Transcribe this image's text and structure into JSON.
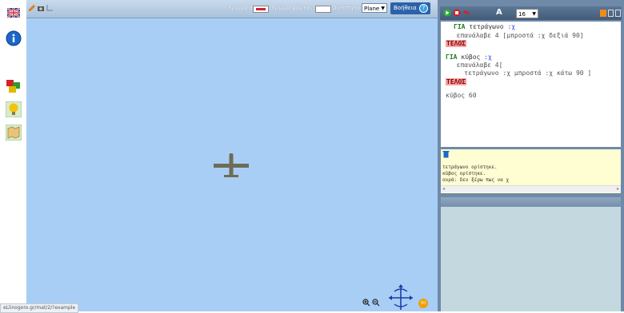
{
  "canvas_toolbar": {
    "pen_color_label": "Χρώμα στυλό:",
    "bg_color_label": "Χρώμα φόντου:",
    "object_label": "Οντότητα:",
    "object_value": "Plane",
    "help_label": "Βοήθεια",
    "help_symbol": "?"
  },
  "status_url": "eLlinogoro.gr/mat/2/?example",
  "nav_badge": "50",
  "editor": {
    "font_size_value": "16",
    "font_label": "A"
  },
  "code_lines": [
    {
      "k": "ΓΙΑ",
      "r": " τετράγωνο ",
      "v": ":χ"
    },
    {
      "t": "  επανάλαβε 4 [μπροστά :χ δεξιά 90]"
    },
    {
      "e": "ΤΕΛΟΣ"
    },
    {
      "k": "ΓΙΑ",
      "r": " κύβος ",
      "v": ":χ"
    },
    {
      "t": "  επανάλαβε 4["
    },
    {
      "t": "    τετράγωνο :χ μπροστά :χ κάτω 90 ]"
    },
    {
      "e": "ΤΕΛΟΣ"
    },
    {
      "t": "κύβος 60"
    }
  ],
  "console": [
    "τετράγωνο ορίστηκε.",
    "κύβος ορίστηκε.",
    "ουρά: δεν ξέρω πως να χ"
  ],
  "colors": {
    "canvas_bg": "#a8cef6",
    "pen_color": "#d6202a",
    "plane_color": "#6f6b55",
    "keyword_green": "#1c7a1c",
    "end_bg": "#f3a4a4"
  }
}
